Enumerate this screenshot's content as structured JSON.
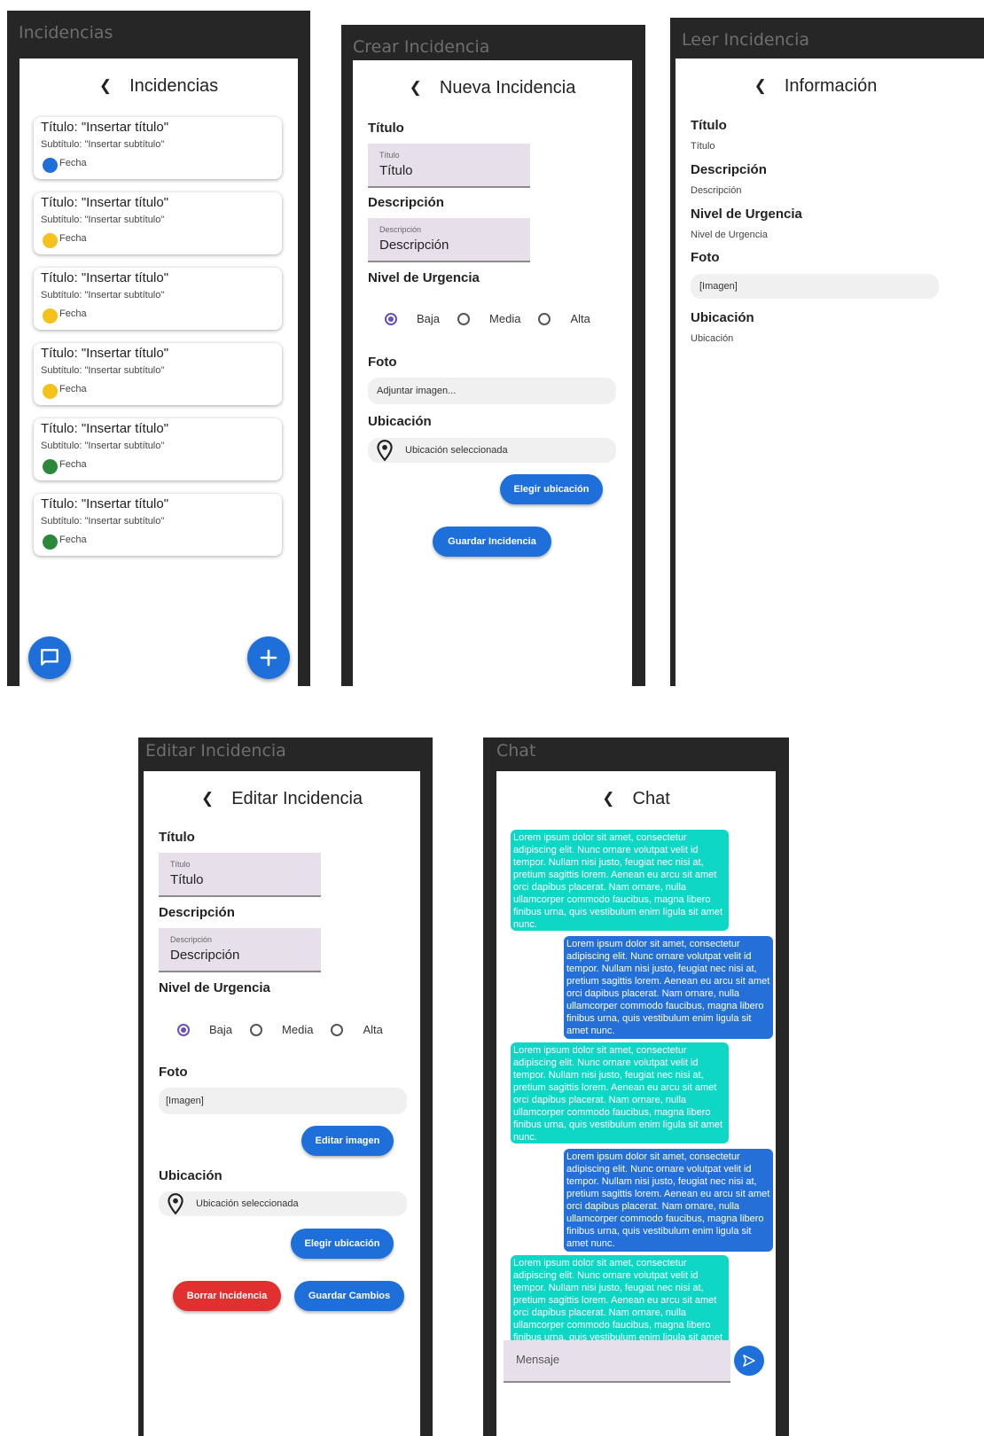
{
  "frames": {
    "list": "Incidencias",
    "create": "Crear Incidencia",
    "read": "Leer Incidencia",
    "edit": "Editar Incidencia",
    "chat": "Chat"
  },
  "list_screen": {
    "header": "Incidencias",
    "back_icon": "chevron-left-icon",
    "cards": [
      {
        "title": "Título: \"Insertar título\"",
        "subtitle": "Subtítulo: \"Insertar subtítulo\"",
        "date": "Fecha",
        "color": "#1e6fd9"
      },
      {
        "title": "Título: \"Insertar título\"",
        "subtitle": "Subtítulo: \"Insertar subtítulo\"",
        "date": "Fecha",
        "color": "#f5c21b"
      },
      {
        "title": "Título: \"Insertar título\"",
        "subtitle": "Subtítulo: \"Insertar subtítulo\"",
        "date": "Fecha",
        "color": "#f5c21b"
      },
      {
        "title": "Título: \"Insertar título\"",
        "subtitle": "Subtítulo: \"Insertar subtítulo\"",
        "date": "Fecha",
        "color": "#f5c21b"
      },
      {
        "title": "Título: \"Insertar título\"",
        "subtitle": "Subtítulo: \"Insertar subtítulo\"",
        "date": "Fecha",
        "color": "#2a8a3a"
      },
      {
        "title": "Título: \"Insertar título\"",
        "subtitle": "Subtítulo: \"Insertar subtítulo\"",
        "date": "Fecha",
        "color": "#2a8a3a"
      }
    ],
    "fab_chat_icon": "chat-bubble-icon",
    "fab_add_icon": "plus-icon"
  },
  "create_screen": {
    "header": "Nueva Incidencia",
    "title_section": "Título",
    "title_field_label": "Título",
    "title_field_value": "Título",
    "desc_section": "Descripción",
    "desc_field_label": "Descripción",
    "desc_field_value": "Descripción",
    "urgency_section": "Nivel de Urgencia",
    "urgency_options": [
      "Baja",
      "Media",
      "Alta"
    ],
    "urgency_selected": "Baja",
    "photo_section": "Foto",
    "photo_placeholder": "Adjuntar imagen...",
    "location_section": "Ubicación",
    "location_value": "Ubicación seleccionada",
    "choose_location_button": "Elegir ubicación",
    "save_button": "Guardar Incidencia"
  },
  "read_screen": {
    "header": "Información",
    "title_section": "Título",
    "title_value": "Título",
    "desc_section": "Descripción",
    "desc_value": "Descripción",
    "urgency_section": "Nivel de Urgencia",
    "urgency_value": "Nivel de Urgencia",
    "photo_section": "Foto",
    "photo_value": "[Imagen]",
    "location_section": "Ubicación",
    "location_value": "Ubicación"
  },
  "edit_screen": {
    "header": "Editar Incidencia",
    "title_section": "Título",
    "title_field_label": "Título",
    "title_field_value": "Título",
    "desc_section": "Descripción",
    "desc_field_label": "Descripción",
    "desc_field_value": "Descripción",
    "urgency_section": "Nivel de Urgencia",
    "urgency_options": [
      "Baja",
      "Media",
      "Alta"
    ],
    "urgency_selected": "Baja",
    "photo_section": "Foto",
    "photo_value": "[Imagen]",
    "edit_image_button": "Editar imagen",
    "location_section": "Ubicación",
    "location_value": "Ubicación seleccionada",
    "choose_location_button": "Elegir ubicación",
    "delete_button": "Borrar Incidencia",
    "save_button": "Guardar Cambios"
  },
  "chat_screen": {
    "header": "Chat",
    "lorem": "Lorem ipsum dolor sit amet, consectetur adipiscing elit. Nunc ornare volutpat velit id tempor. Nullam nisi justo, feugiat nec nisi at, pretium sagittis lorem. Aenean eu arcu sit amet orci dapibus placerat. Nam ornare, nulla ullamcorper commodo faucibus, magna libero finibus urna, quis vestibulum enim ligula sit amet nunc.",
    "message_placeholder": "Mensaje",
    "send_icon": "send-icon"
  },
  "colors": {
    "primary": "#1e6fd9",
    "danger": "#e0302f",
    "teal_bubble": "#0fd7c5",
    "blue_bubble": "#2470d8",
    "radio_selected": "#6a4fb8"
  }
}
